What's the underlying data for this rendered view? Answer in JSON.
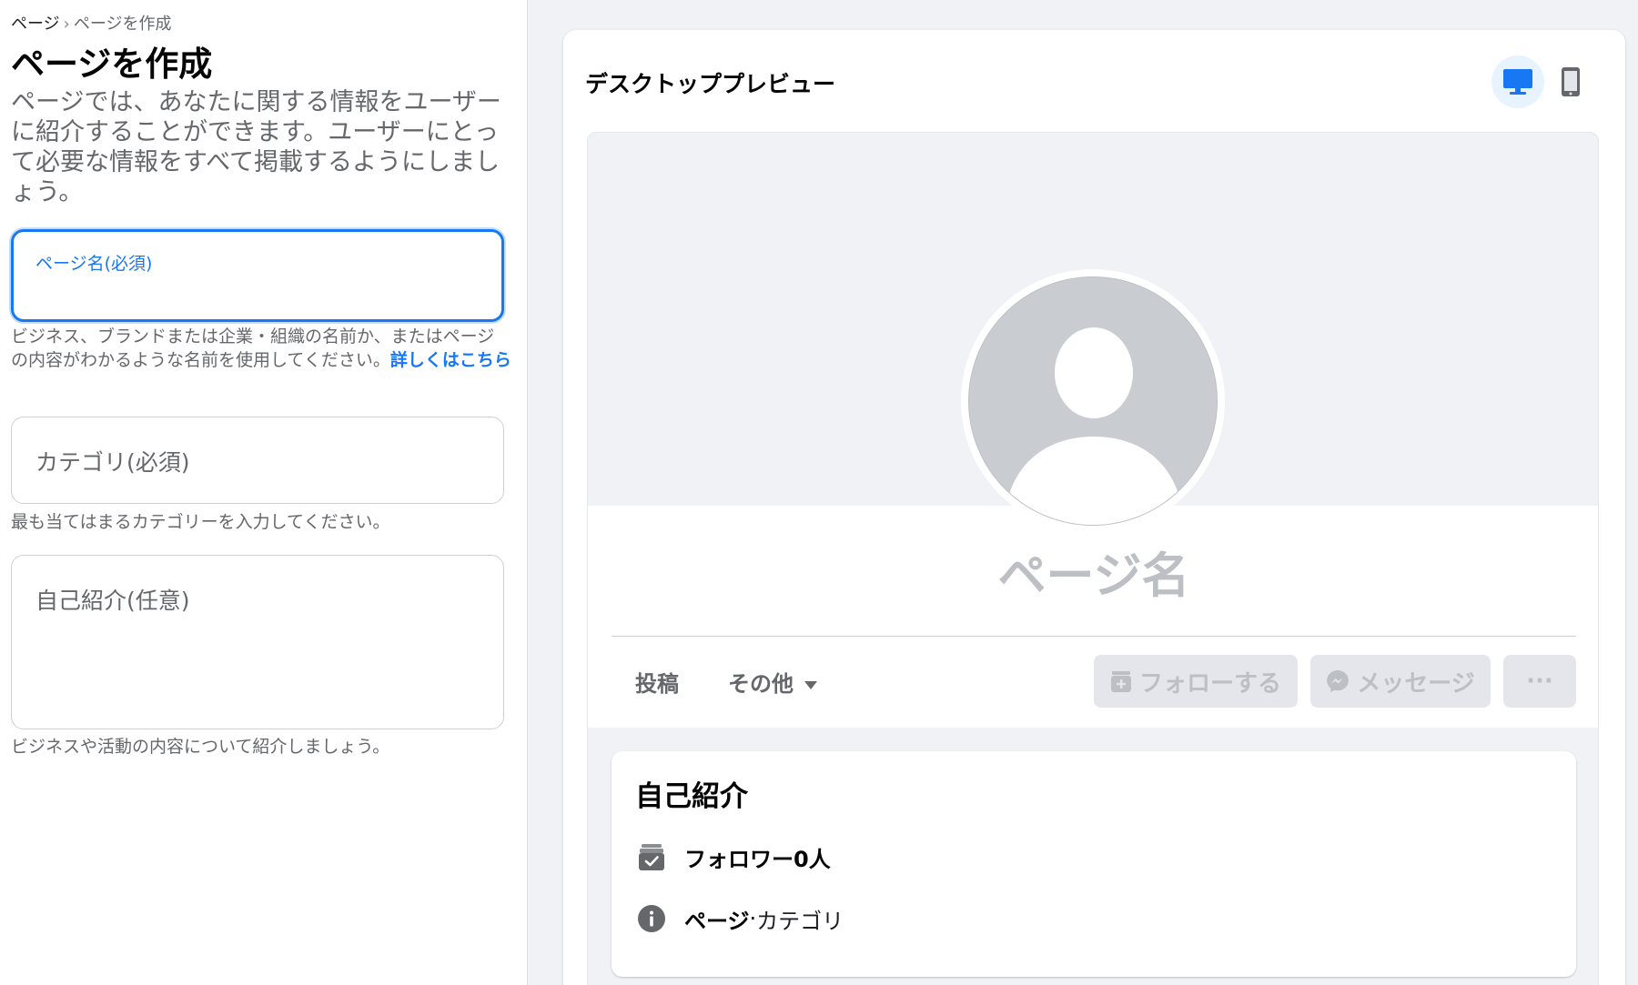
{
  "breadcrumb": {
    "root": "ページ",
    "separator": "›",
    "current": "ページを作成"
  },
  "page_title": "ページを作成",
  "page_description": "ページでは、あなたに関する情報をユーザーに紹介することができます。ユーザーにとって必要な情報をすべて掲載するようにしましょう。",
  "form": {
    "name": {
      "label": "ページ名(必須)",
      "value": "",
      "help": "ビジネス、ブランドまたは企業・組織の名前か、またはページの内容がわかるような名前を使用してください。",
      "help_link": "詳しくはこちら"
    },
    "category": {
      "placeholder": "カテゴリ(必須)",
      "value": "",
      "help": "最も当てはまるカテゴリーを入力してください。"
    },
    "bio": {
      "placeholder": "自己紹介(任意)",
      "value": "",
      "help": "ビジネスや活動の内容について紹介しましょう。"
    }
  },
  "preview": {
    "title": "デスクトッププレビュー",
    "selected_device": "desktop",
    "page_name": "ページ名",
    "tabs": {
      "posts": "投稿",
      "more": "その他"
    },
    "actions": {
      "follow": "フォローする",
      "message": "メッセージ",
      "more": "···"
    },
    "intro": {
      "title": "自己紹介",
      "followers": "フォロワー0人",
      "page_label": "ページ",
      "category_sep": " · ",
      "category": "カテゴリ"
    }
  },
  "colors": {
    "accent": "#1877f2",
    "muted": "#65676b",
    "disabled": "#bcc0c4",
    "background": "#f0f2f5"
  }
}
